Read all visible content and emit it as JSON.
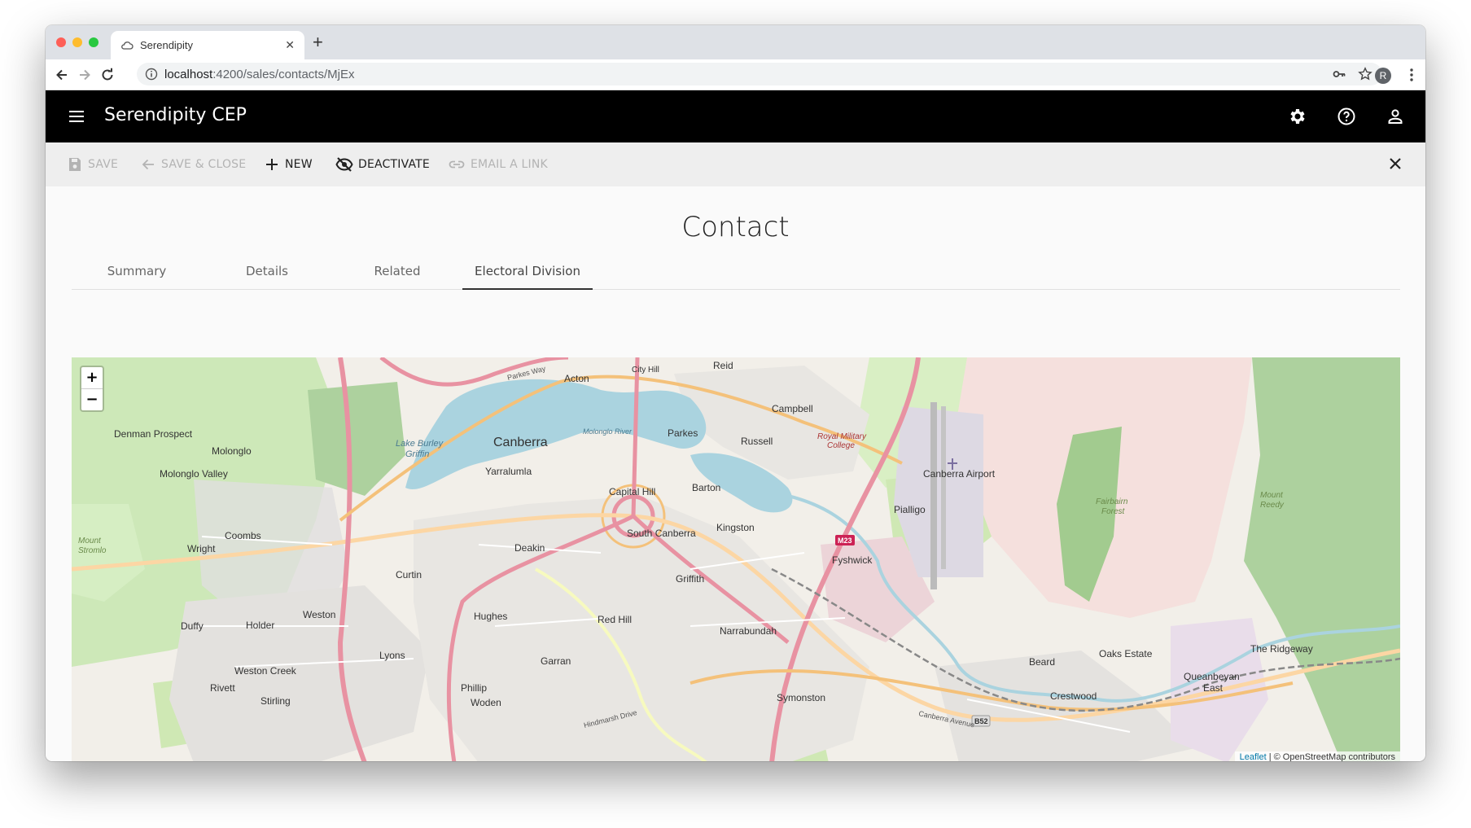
{
  "browser": {
    "tab_title": "Serendipity",
    "url_host": "localhost",
    "url_rest": ":4200/sales/contacts/MjEx",
    "profile_initial": "R"
  },
  "app": {
    "title": "Serendipity CEP",
    "header_icons": [
      "settings-icon",
      "help-icon",
      "account-icon"
    ]
  },
  "commands": {
    "save": "SAVE",
    "save_close": "SAVE & CLOSE",
    "new": "NEW",
    "deactivate": "DEACTIVATE",
    "email_link": "EMAIL A LINK",
    "disabled": [
      "save",
      "save_close",
      "email_link"
    ]
  },
  "page": {
    "title": "Contact",
    "tabs": [
      {
        "label": "Summary"
      },
      {
        "label": "Details"
      },
      {
        "label": "Related"
      },
      {
        "label": "Electoral Division",
        "active": true
      }
    ]
  },
  "map": {
    "zoom_in": "+",
    "zoom_out": "−",
    "attribution_link": "Leaflet",
    "attribution_text": " | © OpenStreetMap contributors",
    "places": [
      "Reid",
      "Acton",
      "City Hill",
      "Campbell",
      "Canberra",
      "Parkes",
      "Russell",
      "Royal Military College",
      "Denman Prospect",
      "Molonglo",
      "Molonglo Valley",
      "Yarralumla",
      "Capital Hill",
      "Barton",
      "Canberra Airport",
      "Pialligo",
      "Kingston",
      "South Canberra",
      "Deakin",
      "Coombs",
      "Wright",
      "Fyshwick",
      "Curtin",
      "Griffith",
      "Red Hill",
      "Hughes",
      "Weston",
      "Duffy",
      "Holder",
      "Narrabundah",
      "Lyons",
      "Garran",
      "Weston Creek",
      "Rivett",
      "Stirling",
      "Phillip",
      "Woden",
      "Symonston",
      "Beard",
      "Oaks Estate",
      "Crestwood",
      "Queanbeyan East",
      "The Ridgeway",
      "Fairbairn Forest",
      "Mount Stromlo",
      "Mount Reedy",
      "Lake Burley Griffin",
      "Molonglo River"
    ],
    "road_labels": [
      "M23",
      "B52",
      "Parkes Way",
      "Canberra Avenue",
      "Hindmarsh Drive"
    ]
  }
}
